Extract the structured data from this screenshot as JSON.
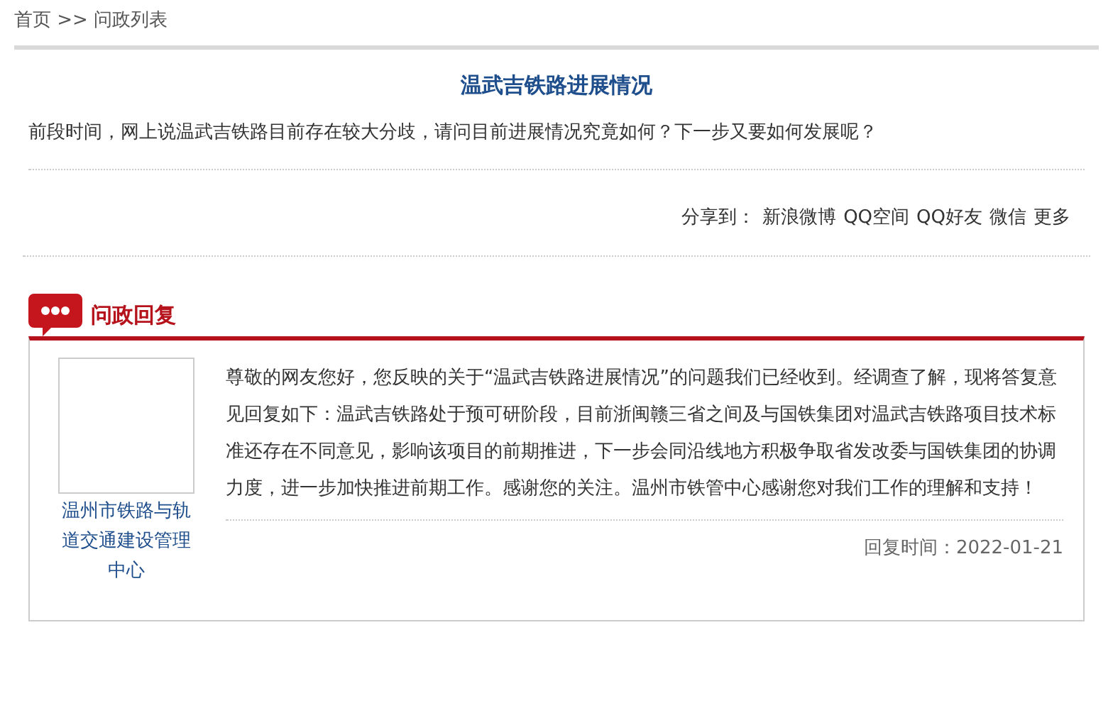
{
  "breadcrumb": {
    "items": [
      "首页",
      "问政列表"
    ],
    "separator": ">>"
  },
  "question": {
    "title": "温武吉铁路进展情况",
    "body": "前段时间，网上说温武吉铁路目前存在较大分歧，请问目前进展情况究竟如何？下一步又要如何发展呢？"
  },
  "share": {
    "label": "分享到：",
    "links": [
      "新浪微博",
      "QQ空间",
      "QQ好友",
      "微信",
      "更多"
    ]
  },
  "reply": {
    "heading": "问政回复",
    "department": "温州市铁路与轨道交通建设管理中心",
    "body": "尊敬的网友您好，您反映的关于“温武吉铁路进展情况”的问题我们已经收到。经调查了解，现将答复意见回复如下：温武吉铁路处于预可研阶段，目前浙闽赣三省之间及与国铁集团对温武吉铁路项目技术标准还存在不同意见，影响该项目的前期推进，下一步会同沿线地方积极争取省发改委与国铁集团的协调力度，进一步加快推进前期工作。感谢您的关注。温州市铁管中心感谢您对我们工作的理解和支持！",
    "time": "回复时间：2022-01-21"
  }
}
